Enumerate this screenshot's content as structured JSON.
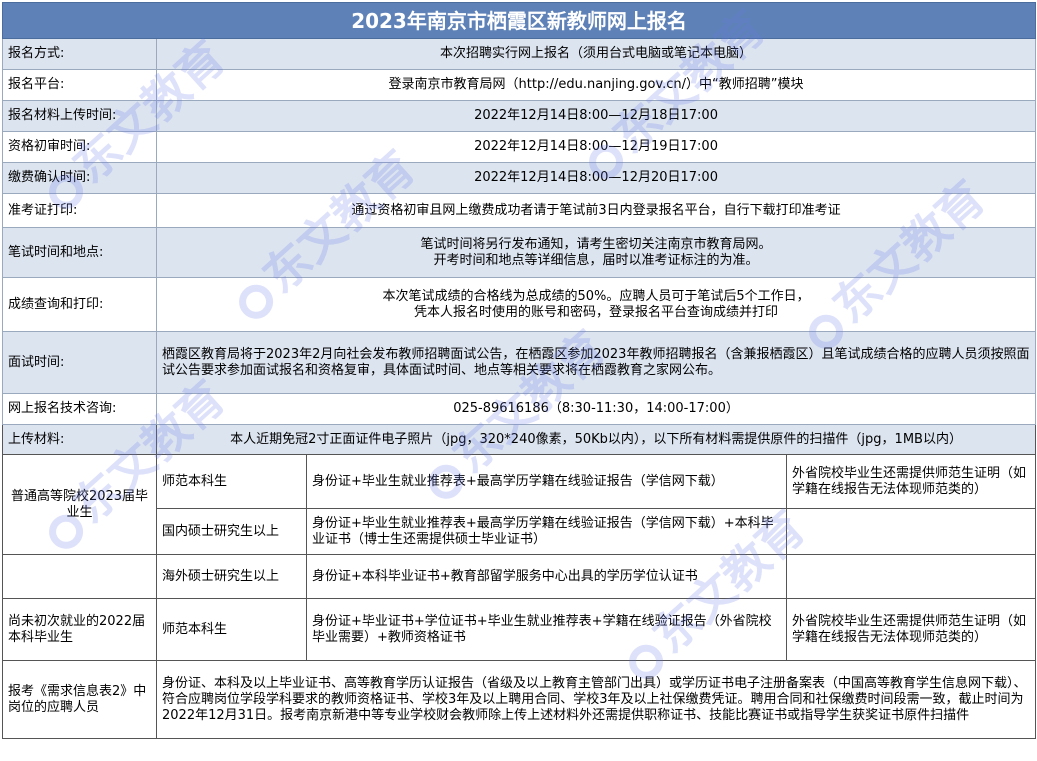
{
  "title": "2023年南京市栖霞区新教师网上报名",
  "rows": [
    {
      "label": "报名方式:",
      "value": "本次招聘实行网上报名（须用台式电脑或笔记本电脑）"
    },
    {
      "label": "报名平台:",
      "value": "登录南京市教育局网（http://edu.nanjing.gov.cn/）中“教师招聘”模块"
    },
    {
      "label": "报名材料上传时间:",
      "value": "2022年12月14日8:00—12月18日17:00"
    },
    {
      "label": "资格初审时间:",
      "value": "2022年12月14日8:00—12月19日17:00"
    },
    {
      "label": "缴费确认时间:",
      "value": "2022年12月14日8:00—12月20日17:00"
    },
    {
      "label": "准考证打印:",
      "value": "通过资格初审且网上缴费成功者请于笔试前3日内登录报名平台，自行下载打印准考证"
    },
    {
      "label": "笔试时间和地点:",
      "value_lines": [
        "笔试时间将另行发布通知，请考生密切关注南京市教育局网。",
        "开考时间和地点等详细信息，届时以准考证标注的为准。"
      ]
    },
    {
      "label": "成绩查询和打印:",
      "value_lines": [
        "本次笔试成绩的合格线为总成绩的50%。应聘人员可于笔试后5个工作日，",
        "凭本人报名时使用的账号和密码，登录报名平台查询成绩并打印"
      ]
    },
    {
      "label": "面试时间:",
      "value": "栖霞区教育局将于2023年2月向社会发布教师招聘面试公告，在栖霞区参加2023年教师招聘报名（含兼报栖霞区）且笔试成绩合格的应聘人员须按照面试公告要求参加面试报名和资格复审，具体面试时间、地点等相关要求将在栖霞教育之家网公布。"
    },
    {
      "label": "网上报名技术咨询:",
      "value": "025-89616186（8:30-11:30，14:00-17:00）"
    }
  ],
  "upload": {
    "label": "上传材料:",
    "value": "本人近期免冠2寸正面证件电子照片（jpg，320*240像素，50Kb以内），以下所有材料需提供原件的扫描件（jpg，1MB以内）"
  },
  "groups": [
    {
      "name": "普通高等院校2023届毕业生",
      "rows": [
        {
          "type": "师范本科生",
          "materials": "身份证+毕业生就业推荐表+最高学历学籍在线验证报告（学信网下载）",
          "note": "外省院校毕业生还需提供师范生证明（如学籍在线报告无法体现师范类的）"
        },
        {
          "type": "国内硕士研究生以上",
          "materials": "身份证+毕业生就业推荐表+最高学历学籍在线验证报告（学信网下载）+本科毕业证书（博士生还需提供硕士毕业证书）",
          "note": ""
        },
        {
          "type": "海外硕士研究生以上",
          "materials": "身份证+本科毕业证书+教育部留学服务中心出具的学历学位认证书",
          "note": ""
        }
      ]
    },
    {
      "name": "尚未初次就业的2022届本科毕业生",
      "rows": [
        {
          "type": "师范本科生",
          "materials": "身份证+毕业证书+学位证书+毕业生就业推荐表+学籍在线验证报告（外省院校毕业需要）+教师资格证书",
          "note": "外省院校毕业生还需提供师范生证明（如学籍在线报告无法体现师范类的）"
        }
      ]
    }
  ],
  "req": {
    "label": "报考《需求信息表2》中岗位的应聘人员",
    "value": "身份证、本科及以上毕业证书、高等教育学历认证报告（省级及以上教育主管部门出具）或学历证书电子注册备案表（中国高等教育学生信息网下载）、符合应聘岗位学段学科要求的教师资格证书、学校3年及以上聘用合同、学校3年及以上社保缴费凭证。聘用合同和社保缴费时间段需一致，截止时间为2022年12月31日。报考南京新港中等专业学校财会教师除上传上述材料外还需提供职称证书、技能比赛证书或指导学生获奖证书原件扫描件"
  },
  "watermark": "东文教育"
}
